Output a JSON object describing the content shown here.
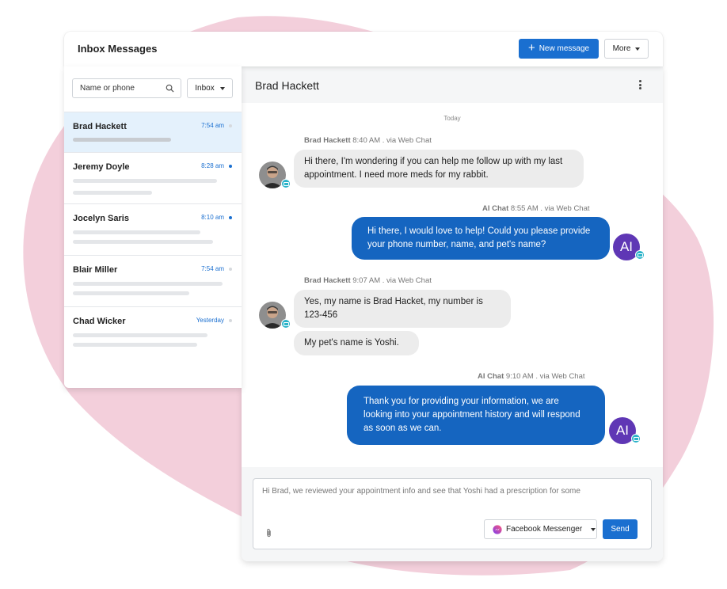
{
  "window": {
    "title": "Inbox Messages"
  },
  "toolbar": {
    "new_message_label": "New message",
    "more_label": "More"
  },
  "sidebar": {
    "search_placeholder": "Name or phone",
    "folder_select": "Inbox",
    "conversations": [
      {
        "name": "Brad Hackett",
        "time": "7:54 am",
        "unread": false,
        "active": true
      },
      {
        "name": "Jeremy Doyle",
        "time": "8:28 am",
        "unread": true,
        "active": false
      },
      {
        "name": "Jocelyn Saris",
        "time": "8:10 am",
        "unread": true,
        "active": false
      },
      {
        "name": "Blair Miller",
        "time": "7:54 am",
        "unread": false,
        "active": false
      },
      {
        "name": "Chad Wicker",
        "time": "Yesterday",
        "unread": false,
        "active": false
      }
    ]
  },
  "chat": {
    "contact_name": "Brad Hackett",
    "day_divider": "Today",
    "messages": [
      {
        "sender": "Brad Hackett",
        "meta": "8:40 AM . via Web Chat",
        "direction": "in",
        "bubbles": [
          "Hi there, I'm wondering if you can help me follow up with my last appointment. I need more meds for my rabbit."
        ]
      },
      {
        "sender": "AI Chat",
        "meta": "8:55 AM . via Web Chat",
        "direction": "out",
        "avatar_text": "AI",
        "bubbles": [
          "Hi there, I would love to help! Could you please provide your phone number, name, and pet's name?"
        ]
      },
      {
        "sender": "Brad Hackett",
        "meta": "9:07 AM . via Web Chat",
        "direction": "in",
        "bubbles": [
          "Yes, my name is Brad Hacket, my number is 123-456",
          "My pet's name is Yoshi."
        ]
      },
      {
        "sender": "AI Chat",
        "meta": "9:10 AM . via Web Chat",
        "direction": "out",
        "avatar_text": "AI",
        "bubbles": [
          "Thank you for providing your information, we are looking into your appointment history and will respond as soon as we can."
        ]
      }
    ]
  },
  "composer": {
    "draft_text": "Hi Brad, we reviewed your appointment info and see that Yoshi had a prescription for some",
    "channel": "Facebook Messenger",
    "send_label": "Send"
  },
  "colors": {
    "accent": "#1a6fd0",
    "outgoing_bubble": "#1565c0",
    "ai_avatar": "#5f37b5",
    "channel_badge": "#2bb3c9",
    "background_blob": "#f3cfdb"
  }
}
